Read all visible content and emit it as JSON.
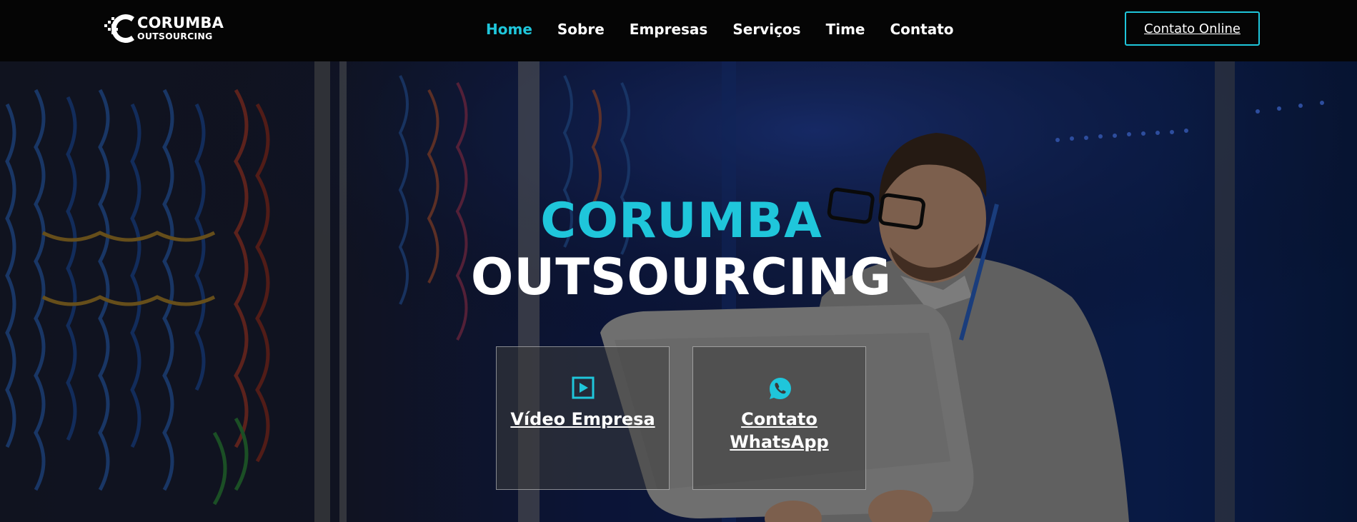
{
  "header": {
    "logo": {
      "line1": "CORUMBA",
      "line2": "OUTSOURCING"
    },
    "nav": [
      {
        "label": "Home",
        "active": true
      },
      {
        "label": "Sobre",
        "active": false
      },
      {
        "label": "Empresas",
        "active": false
      },
      {
        "label": "Serviços",
        "active": false
      },
      {
        "label": "Time",
        "active": false
      },
      {
        "label": "Contato",
        "active": false
      }
    ],
    "cta_label": "Contato Online"
  },
  "hero": {
    "title_line1": "CORUMBA",
    "title_line2": "OUTSOURCING",
    "cards": [
      {
        "label": "Vídeo Empresa",
        "icon": "play-square-icon"
      },
      {
        "label": "Contato WhatsApp",
        "icon": "whatsapp-icon"
      }
    ]
  },
  "colors": {
    "accent": "#1fc6db",
    "header_bg": "#050505",
    "text": "#ffffff"
  }
}
